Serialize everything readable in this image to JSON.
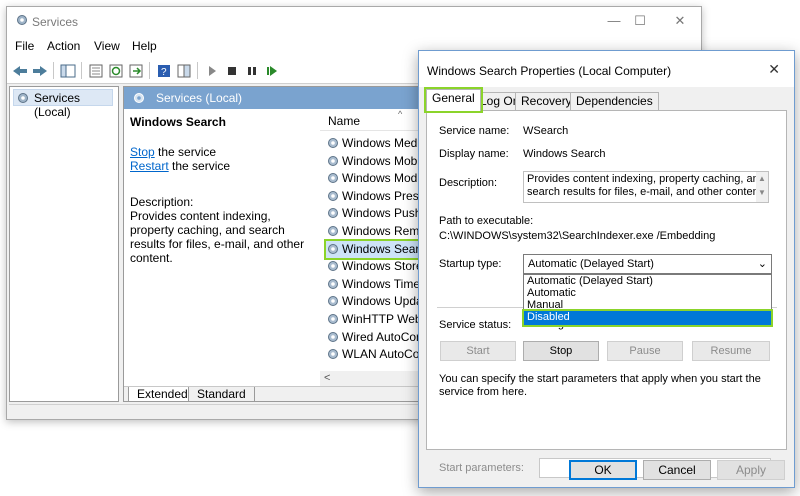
{
  "window": {
    "title": "Services",
    "minimize": "—",
    "maximize": "☐",
    "close": "✕"
  },
  "menu": [
    "File",
    "Action",
    "View",
    "Help"
  ],
  "tree": {
    "root_label": "Services (Local)"
  },
  "main": {
    "header": "Services (Local)",
    "service_name": "Windows Search",
    "stop_link": "Stop",
    "stop_suffix": " the service",
    "restart_link": "Restart",
    "restart_suffix": " the service",
    "description_label": "Description:",
    "description": "Provides content indexing, property caching, and search results for files, e-mail, and other content.",
    "column_name": "Name",
    "services": [
      "Windows Media",
      "Windows Mobile",
      "Windows Modules",
      "Windows Presentation",
      "Windows Push",
      "Windows Remote",
      "Windows Search",
      "Windows Store",
      "Windows Time",
      "Windows Update",
      "WinHTTP Web",
      "Wired AutoConfig",
      "WLAN AutoConfig"
    ],
    "selected_service_index": 6,
    "tabs": [
      "Extended",
      "Standard"
    ]
  },
  "dialog": {
    "title": "Windows Search Properties (Local Computer)",
    "close": "✕",
    "tabs": [
      "General",
      "Log On",
      "Recovery",
      "Dependencies"
    ],
    "service_name_label": "Service name:",
    "service_name": "WSearch",
    "display_name_label": "Display name:",
    "display_name": "Windows Search",
    "description_label": "Description:",
    "description": "Provides content indexing, property caching, and search results for files, e-mail, and other content.",
    "path_label": "Path to executable:",
    "path": "C:\\WINDOWS\\system32\\SearchIndexer.exe /Embedding",
    "startup_type_label": "Startup type:",
    "startup_type_value": "Automatic (Delayed Start)",
    "startup_options": [
      "Automatic (Delayed Start)",
      "Automatic",
      "Manual",
      "Disabled"
    ],
    "startup_highlighted": "Disabled",
    "service_status_label": "Service status:",
    "service_status": "Running",
    "buttons": {
      "start": "Start",
      "stop": "Stop",
      "pause": "Pause",
      "resume": "Resume"
    },
    "hint": "You can specify the start parameters that apply when you start the service from here.",
    "start_params_label": "Start parameters:",
    "start_params_value": "",
    "footer": {
      "ok": "OK",
      "cancel": "Cancel",
      "apply": "Apply"
    }
  },
  "colors": {
    "accent": "#0078d7",
    "highlight_outline": "#8bd42a",
    "header_blue": "#7aa3cf"
  }
}
